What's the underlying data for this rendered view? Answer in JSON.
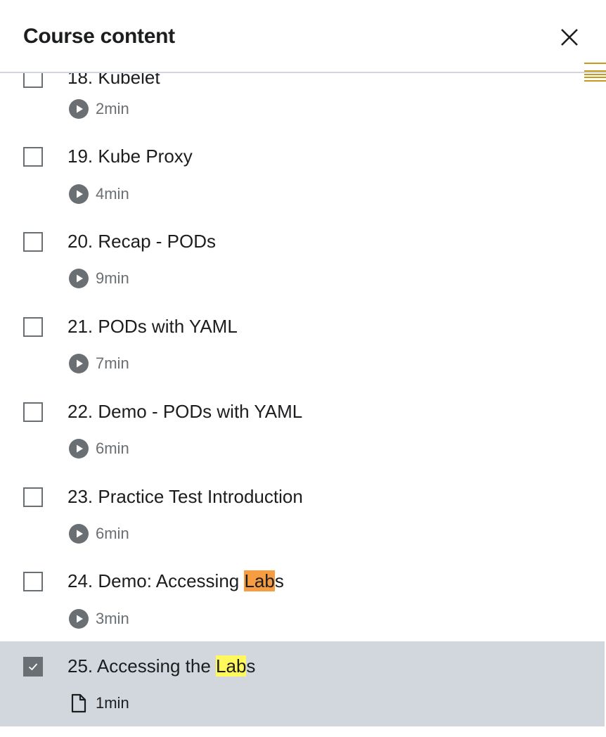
{
  "header": {
    "title": "Course content"
  },
  "items": [
    {
      "title": "18. Kubelet",
      "duration": "2min",
      "type": "video",
      "checked": false
    },
    {
      "title": "19. Kube Proxy",
      "duration": "4min",
      "type": "video",
      "checked": false
    },
    {
      "title": "20. Recap - PODs",
      "duration": "9min",
      "type": "video",
      "checked": false
    },
    {
      "title": "21. PODs with YAML",
      "duration": "7min",
      "type": "video",
      "checked": false
    },
    {
      "title": "22. Demo - PODs with YAML",
      "duration": "6min",
      "type": "video",
      "checked": false
    },
    {
      "title": "23. Practice Test Introduction",
      "duration": "6min",
      "type": "video",
      "checked": false
    },
    {
      "title_pre": "24. Demo: Accessing ",
      "title_hl": "Lab",
      "title_post": "s",
      "duration": "3min",
      "type": "video",
      "checked": false
    },
    {
      "title_pre": "25. Accessing the ",
      "title_hl": "Lab",
      "title_post": "s",
      "duration": "1min",
      "type": "article",
      "checked": true,
      "active": true
    }
  ],
  "colors": {
    "orange_highlight": "#f69c41",
    "yellow_highlight": "#fff95e",
    "active_row": "#d1d7dc"
  }
}
